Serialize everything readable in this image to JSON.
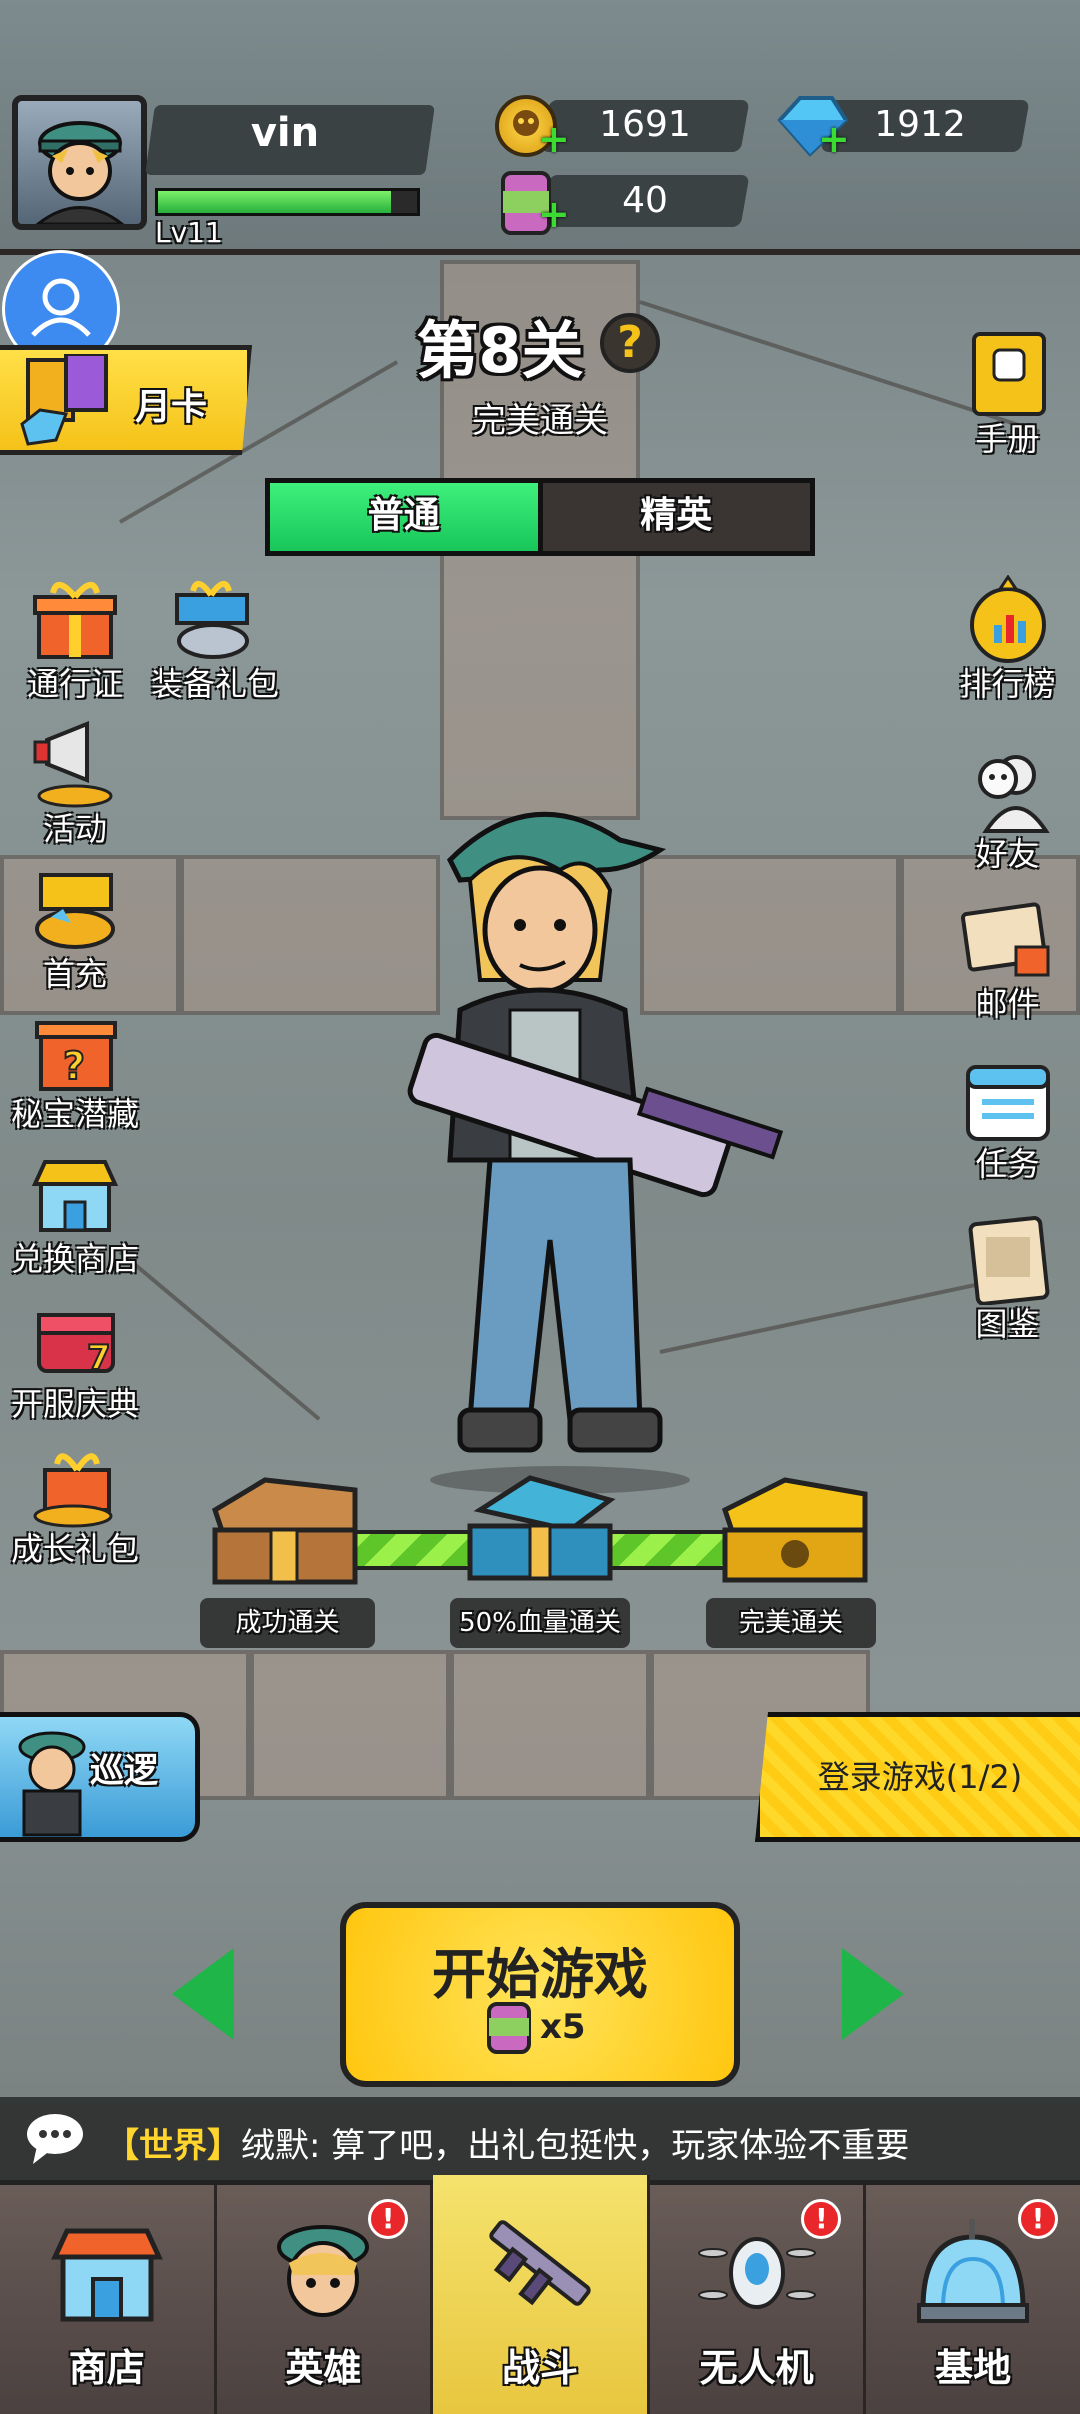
{
  "player": {
    "name": "vin",
    "level": "Lv11",
    "xp_fraction": 0.9
  },
  "resources": {
    "coins": "1691",
    "diamonds": "1912",
    "energy": "40"
  },
  "stage": {
    "title": "第8关",
    "help": "?",
    "status": "完美通关"
  },
  "mode_tabs": [
    {
      "label": "普通",
      "active": true
    },
    {
      "label": "精英",
      "active": false
    }
  ],
  "monthly_card": "月卡",
  "left_menu": [
    {
      "label": "通行证",
      "icon": "gift-box-icon"
    },
    {
      "label": "装备礼包",
      "icon": "equipment-gift-icon"
    },
    {
      "label": "活动",
      "icon": "megaphone-icon"
    },
    {
      "label": "首充",
      "icon": "treasure-chest-icon"
    },
    {
      "label": "秘宝潜藏",
      "icon": "mystery-box-icon"
    },
    {
      "label": "兑换商店",
      "icon": "shop-icon"
    },
    {
      "label": "开服庆典",
      "icon": "celebration-chest-icon"
    },
    {
      "label": "成长礼包",
      "icon": "growth-gift-icon"
    }
  ],
  "right_menu": [
    {
      "label": "手册",
      "icon": "handbook-icon"
    },
    {
      "label": "排行榜",
      "icon": "trophy-icon"
    },
    {
      "label": "好友",
      "icon": "friends-icon"
    },
    {
      "label": "邮件",
      "icon": "mail-icon"
    },
    {
      "label": "任务",
      "icon": "calendar-icon"
    },
    {
      "label": "图鉴",
      "icon": "codex-icon"
    }
  ],
  "chests": [
    {
      "label": "成功通关"
    },
    {
      "label": "50%血量通关"
    },
    {
      "label": "完美通关"
    }
  ],
  "patrol": "巡逻",
  "login_task": "登录游戏(1/2)",
  "start": {
    "label": "开始游戏",
    "cost": "x5"
  },
  "chat": {
    "channel": "【世界】",
    "message": "绒默: 算了吧，出礼包挺快，玩家体验不重要"
  },
  "bottom_nav": [
    {
      "label": "商店",
      "icon": "shop-icon",
      "badge": "",
      "active": false
    },
    {
      "label": "英雄",
      "icon": "hero-icon",
      "badge": "!",
      "active": false
    },
    {
      "label": "战斗",
      "icon": "rifle-icon",
      "badge": "",
      "active": true
    },
    {
      "label": "无人机",
      "icon": "drone-icon",
      "badge": "!",
      "active": false
    },
    {
      "label": "基地",
      "icon": "dome-base-icon",
      "badge": "!",
      "active": false
    }
  ],
  "colors": {
    "accent_green": "#18c65a",
    "accent_yellow": "#ffc60f",
    "badge_red": "#e9262a"
  }
}
